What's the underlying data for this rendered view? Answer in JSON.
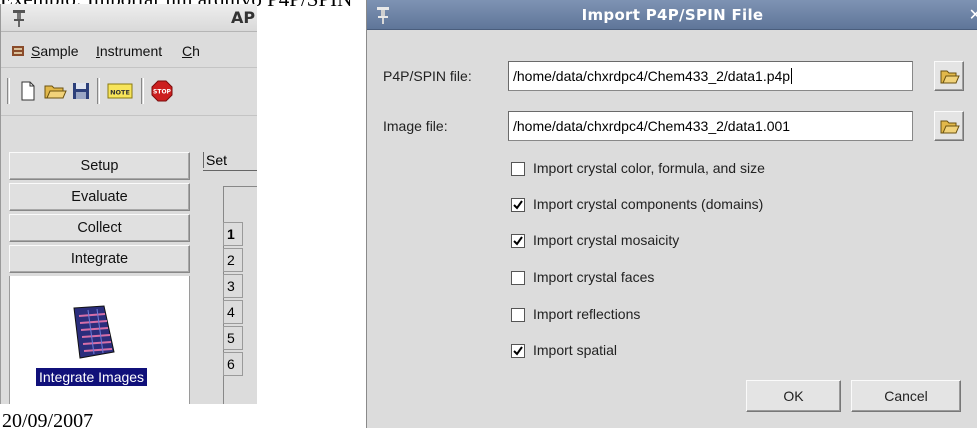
{
  "document": {
    "top_text": "[…] Sample … Import … Import …",
    "date": "20/09/2007"
  },
  "main_window": {
    "title": "AP",
    "menu": [
      "Sample",
      "Instrument",
      "Ch"
    ],
    "toolbar_icons": [
      "new-file-icon",
      "open-folder-icon",
      "save-disk-icon",
      "note-icon",
      "stop-icon"
    ],
    "nav_buttons": [
      "Setup",
      "Evaluate",
      "Collect",
      "Integrate"
    ],
    "nav_panel_item": "Integrate Images",
    "tab_label": "Set",
    "row_numbers": [
      "1",
      "2",
      "3",
      "4",
      "5",
      "6"
    ]
  },
  "dialog": {
    "title": "Import P4P/SPIN File",
    "p4p_label": "P4P/SPIN file:",
    "p4p_value": "/home/data/chxrdpc4/Chem433_2/data1.p4p",
    "image_label": "Image file:",
    "image_value": "/home/data/chxrdpc4/Chem433_2/data1.001",
    "options": [
      {
        "label": "Import crystal color, formula, and size",
        "checked": false
      },
      {
        "label": "Import crystal components (domains)",
        "checked": true
      },
      {
        "label": "Import crystal mosaicity",
        "checked": true
      },
      {
        "label": "Import crystal faces",
        "checked": false
      },
      {
        "label": "Import reflections",
        "checked": false
      },
      {
        "label": "Import spatial",
        "checked": true
      }
    ],
    "ok_label": "OK",
    "cancel_label": "Cancel"
  }
}
